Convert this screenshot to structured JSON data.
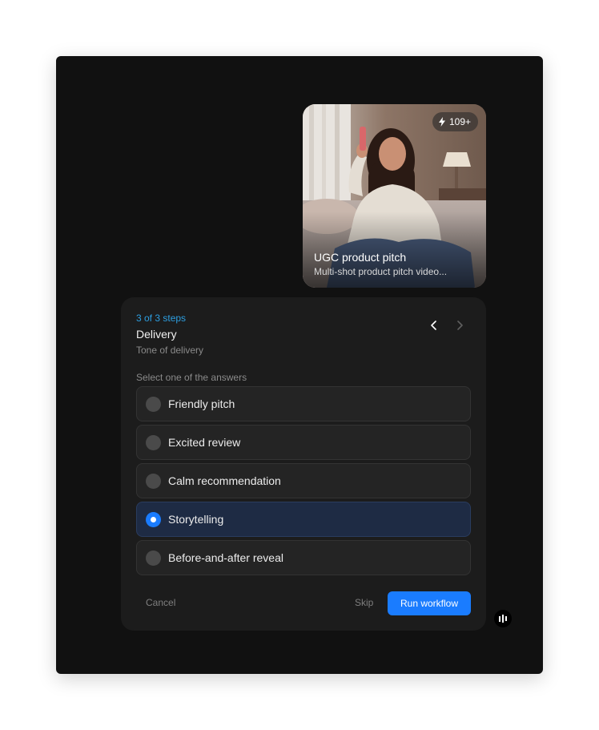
{
  "template_card": {
    "badge_count": "109+",
    "badge_icon": "lightning-icon",
    "title": "UGC product pitch",
    "description": "Multi-shot product pitch video..."
  },
  "question": {
    "step": "3 of 3 steps",
    "title": "Delivery",
    "subtitle": "Tone of delivery",
    "instruction": "Select one of the answers",
    "options": [
      {
        "label": "Friendly pitch",
        "selected": false
      },
      {
        "label": "Excited review",
        "selected": false
      },
      {
        "label": "Calm recommendation",
        "selected": false
      },
      {
        "label": "Storytelling",
        "selected": true
      },
      {
        "label": "Before-and-after reveal",
        "selected": false
      }
    ]
  },
  "actions": {
    "cancel_label": "Cancel",
    "skip_label": "Skip",
    "run_label": "Run workflow"
  },
  "colors": {
    "accent": "#1a7cff",
    "step_text": "#2d9ee0",
    "window_bg": "#111111",
    "panel_bg": "#1c1c1c"
  }
}
